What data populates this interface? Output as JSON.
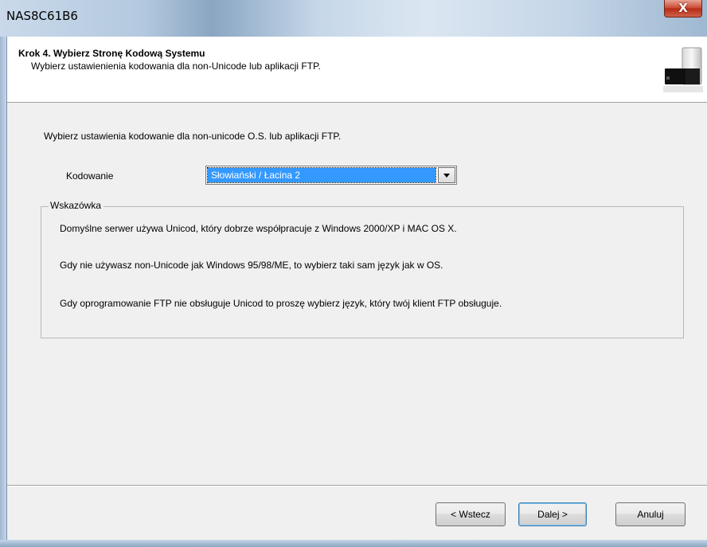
{
  "window": {
    "title": "NAS8C61B6",
    "close_symbol": "X"
  },
  "header": {
    "heading": "Krok 4. Wybierz Stronę Kodową Systemu",
    "subheading": "Wybierz ustawienienia kodowania dla non-Unicode lub aplikacji FTP."
  },
  "main": {
    "intro": "Wybierz ustawienia kodowanie dla non-unicode O.S. lub aplikacji FTP.",
    "encoding_label": "Kodowanie",
    "encoding_value": "Słowiański / Łacina 2"
  },
  "hint": {
    "legend": "Wskazówka",
    "lines": [
      "Domyślne serwer używa Unicod, który dobrze współpracuje z Windows 2000/XP i MAC OS X.",
      "Gdy nie używasz non-Unicode jak Windows 95/98/ME, to wybierz taki sam język jak w OS.",
      "Gdy oprogramowanie FTP nie obsługuje Unicod to proszę wybierz język, który twój klient FTP obsługuje."
    ]
  },
  "buttons": {
    "back": "< Wstecz",
    "next": "Dalej >",
    "cancel": "Anuluj"
  },
  "icons": {
    "header_image": "nas-device-icon",
    "dropdown": "chevron-down-icon",
    "close": "close-icon"
  }
}
